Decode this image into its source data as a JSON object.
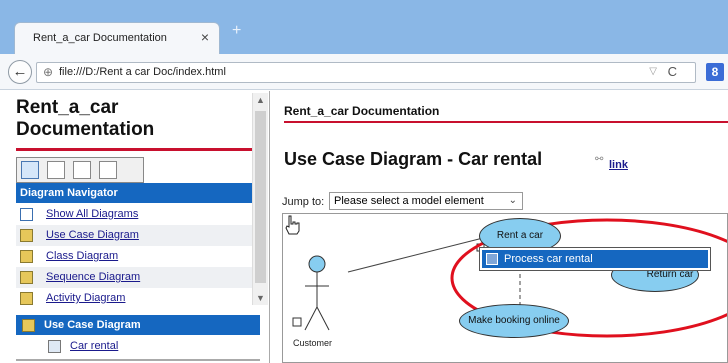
{
  "browser": {
    "tab_title": "Rent_a_car Documentation",
    "tab_close": "×",
    "new_tab": "+",
    "back": "←",
    "url": "file:///D:/Rent a car Doc/index.html",
    "url_dropdown": "▽",
    "reload": "C",
    "search_engine_letter": "8"
  },
  "left_pane": {
    "title": "Rent_a_car Documentation",
    "navigator_header": "Diagram Navigator",
    "items": [
      {
        "label": "Show All Diagrams",
        "icon": "all-diagrams-icon"
      },
      {
        "label": "Use Case Diagram",
        "icon": "use-case-diagram-icon"
      },
      {
        "label": "Class Diagram",
        "icon": "class-diagram-icon"
      },
      {
        "label": "Sequence Diagram",
        "icon": "sequence-diagram-icon"
      },
      {
        "label": "Activity Diagram",
        "icon": "activity-diagram-icon"
      }
    ],
    "current_section": "Use Case Diagram",
    "current_item": "Car rental"
  },
  "right_pane": {
    "doc_title": "Rent_a_car Documentation",
    "diagram_title": "Use Case Diagram - Car rental",
    "link_label": "link",
    "jump_label": "Jump to:",
    "jump_placeholder": "Please select a model element",
    "diagram": {
      "actor": "Customer",
      "use_cases": [
        "Rent a car",
        "Return car",
        "Make booking online"
      ],
      "popup_item": "Process car rental",
      "visible_partial_text": "Return car"
    }
  },
  "colors": {
    "accent_blue": "#1567c0",
    "rule_red": "#c8102e",
    "use_case_fill": "#87cdf0",
    "highlight_ellipse": "#e0101e"
  }
}
